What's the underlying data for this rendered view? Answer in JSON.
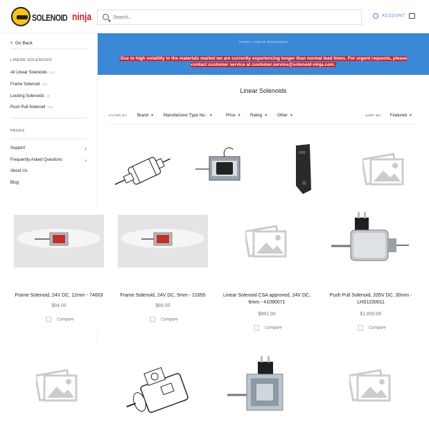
{
  "header": {
    "logo_primary": "SOLENOID",
    "logo_accent": "ninja",
    "search_placeholder": "Search...",
    "account_label": "ACCOUNT"
  },
  "sidebar": {
    "back_label": "Go Back",
    "section_linear": "LINEAR SOLENOIDS",
    "categories": [
      {
        "label": "All Linear Solenoids",
        "count": "(44)"
      },
      {
        "label": "Frame Solenoid",
        "count": "(15)"
      },
      {
        "label": "Locking Solenoids",
        "count": "(3)"
      },
      {
        "label": "Push Pull Solenoid",
        "count": "(26)"
      }
    ],
    "section_pages": "PAGES",
    "pages": [
      {
        "label": "Support"
      },
      {
        "label": "Frequently Asked Questions"
      },
      {
        "label": "About Us"
      },
      {
        "label": "Blog"
      }
    ]
  },
  "main": {
    "breadcrumb": "HOME / LINEAR SOLENOIDS",
    "notice": "Due to high volatility in the materials market we are currently experiencing longer than normal lead times. For urgent requests, please contact customer service at customer.service@solenoid-ninja.com.",
    "title": "Linear Solenoids",
    "filter_label": "FILTER BY:",
    "filters": [
      "Brand",
      "Manufacturer Type No.:",
      "Price",
      "Rating",
      "Other"
    ],
    "sort_label": "SORT BY:",
    "sort_value": "Featured"
  },
  "products": [
    {
      "title": "Frame Solenoid, 24V DC, 12mm - 74603",
      "price": "$94.00",
      "compare": "Compare"
    },
    {
      "title": "Frame Solenoid, 24V DC, 5mm - 21655",
      "price": "$66.00",
      "compare": "Compare"
    },
    {
      "title": "Linear Solenoid CSA approved, 24V DC, 6mm - 41090071",
      "price": "$881.00",
      "compare": "Compare"
    },
    {
      "title": "Push Pull Solenoid, 205V DC, 30mm - LHS1150011",
      "price": "$1,650.00",
      "compare": "Compare"
    }
  ],
  "icons": {
    "search": "search-icon",
    "account": "user-icon",
    "cart": "shopping-bag-icon",
    "placeholder": "image-placeholder-icon"
  },
  "colors": {
    "accent": "#3b88d6",
    "notice_bg": "#d11f26",
    "logo_yellow": "#f5c518",
    "logo_red": "#d0202a"
  }
}
